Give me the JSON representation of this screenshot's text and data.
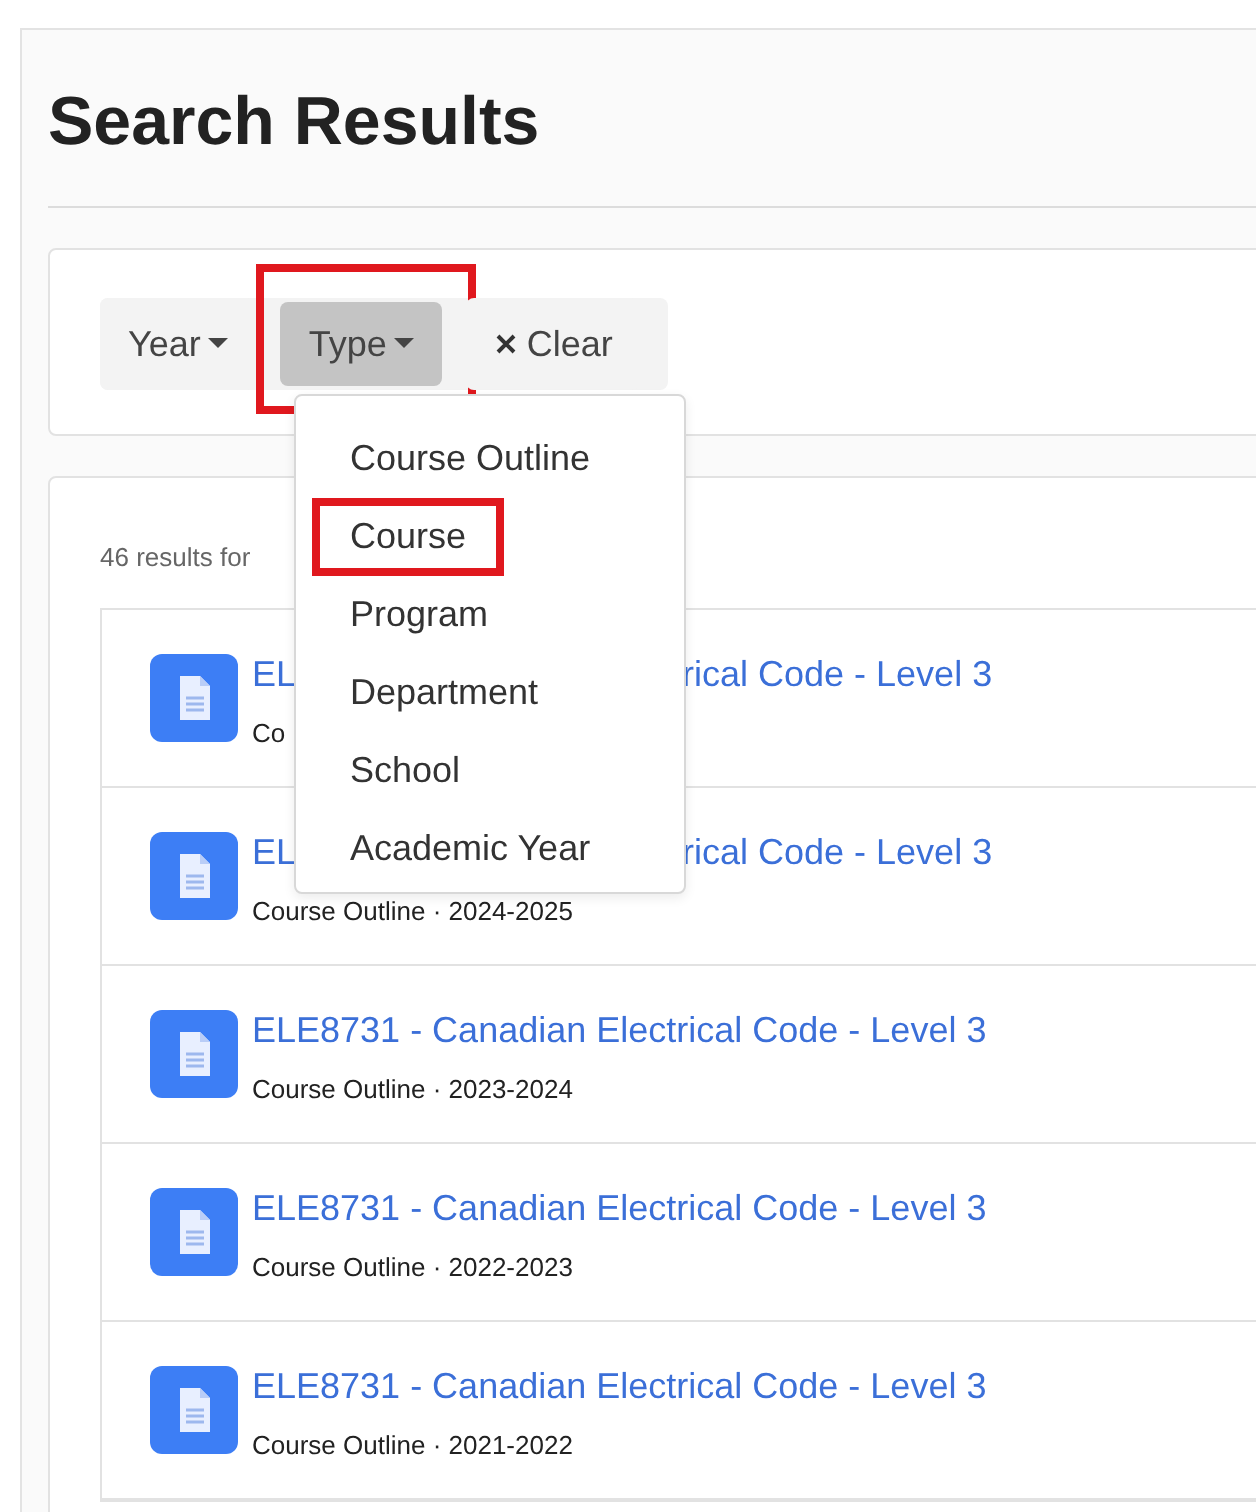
{
  "page": {
    "title": "Search Results"
  },
  "filters": [
    {
      "label": "Year",
      "kind": "dropdown",
      "selected": false,
      "annotated": false
    },
    {
      "label": "Type",
      "kind": "dropdown",
      "selected": true,
      "annotated": true
    },
    {
      "label": "Clear",
      "kind": "clear",
      "selected": false,
      "annotated": false
    }
  ],
  "dropdown": {
    "items": [
      {
        "label": "Course Outline",
        "annotated": false
      },
      {
        "label": "Course",
        "annotated": true
      },
      {
        "label": "Program",
        "annotated": false
      },
      {
        "label": "Department",
        "annotated": false
      },
      {
        "label": "School",
        "annotated": false
      },
      {
        "label": "Academic Year",
        "annotated": false
      }
    ]
  },
  "results": {
    "summary": "46 results for",
    "items": [
      {
        "title": "EL",
        "title_after": "rical Code - Level 3",
        "subtitle": "Co"
      },
      {
        "title": "EL",
        "title_after": "rical Code - Level 3",
        "subtitle": "Course Outline · 2024-2025"
      },
      {
        "title": "ELE8731 - Canadian Electrical Code - Level 3",
        "subtitle": "Course Outline · 2023-2024"
      },
      {
        "title": "ELE8731 - Canadian Electrical Code - Level 3",
        "subtitle": "Course Outline · 2022-2023"
      },
      {
        "title": "ELE8731 - Canadian Electrical Code - Level 3",
        "subtitle": "Course Outline · 2021-2022"
      }
    ]
  }
}
